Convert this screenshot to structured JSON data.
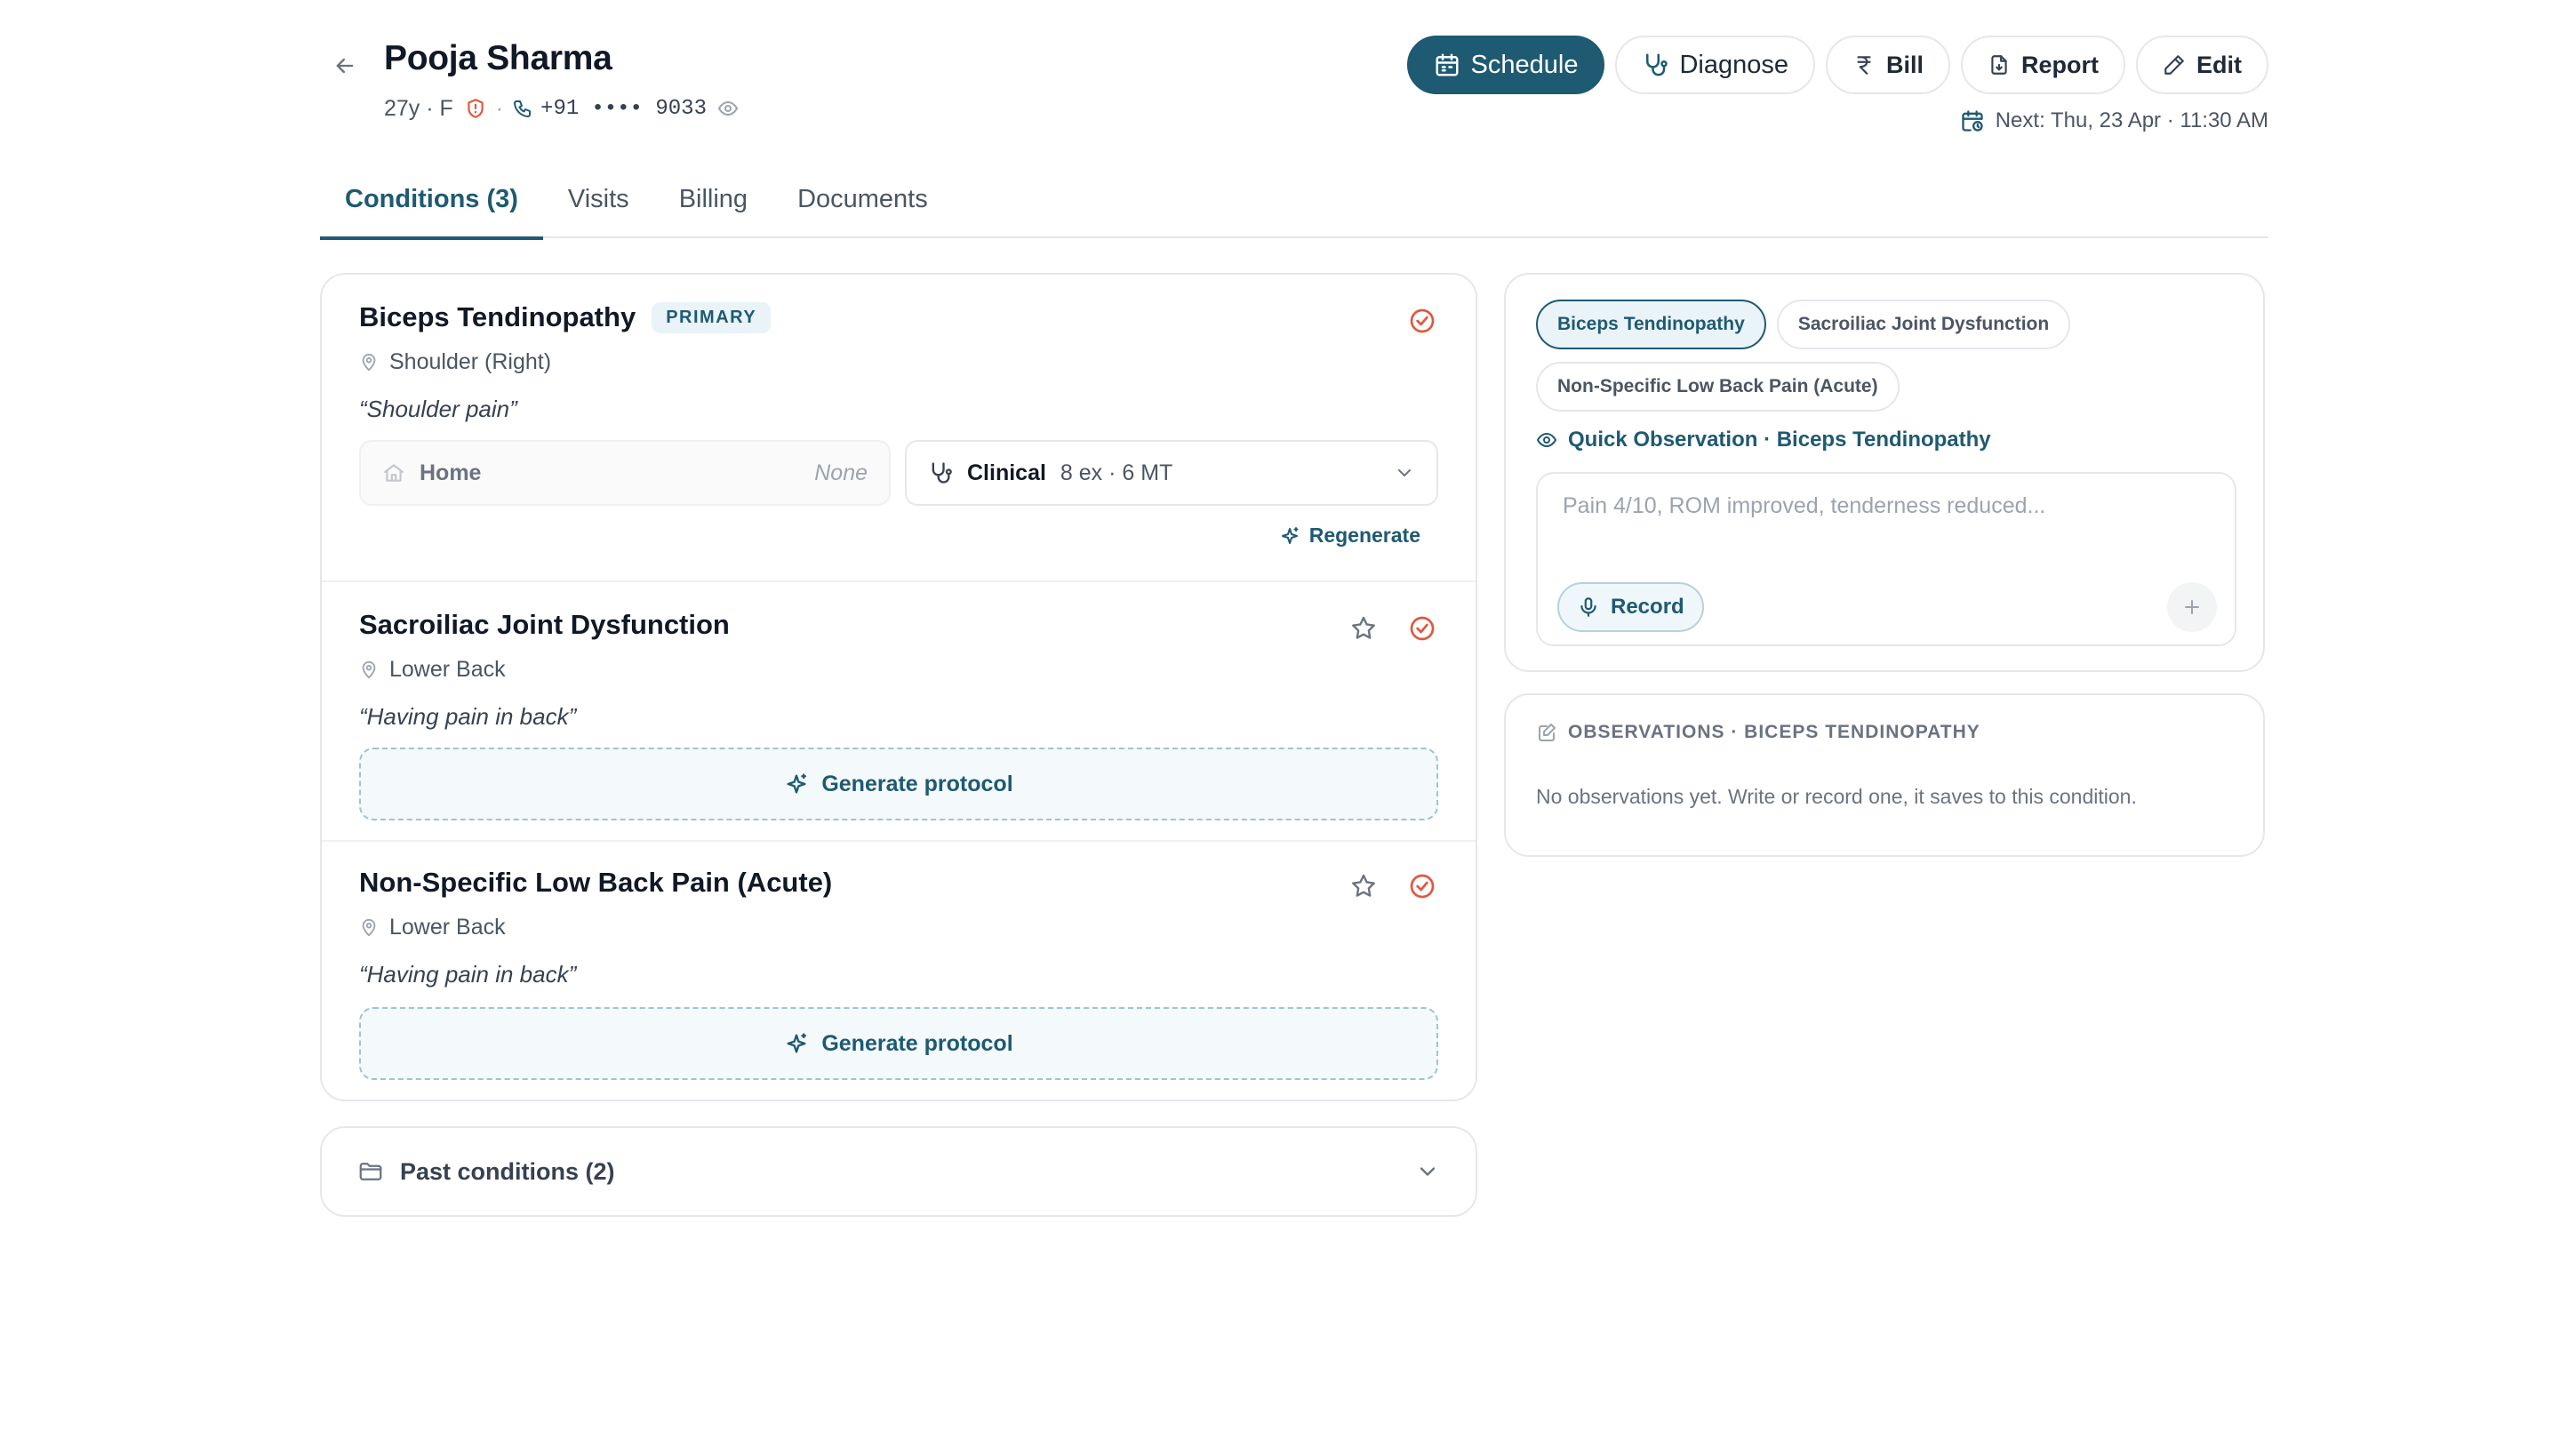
{
  "patient": {
    "name": "Pooja Sharma",
    "age_sex": "27y · F",
    "phone_prefix": "+91",
    "phone_masked": "••••  9033"
  },
  "actions": {
    "schedule": "Schedule",
    "diagnose": "Diagnose",
    "bill": "Bill",
    "report": "Report",
    "edit": "Edit"
  },
  "next_appointment": "Next: Thu, 23 Apr · 11:30 AM",
  "tabs": [
    {
      "label": "Conditions (3)",
      "active": true
    },
    {
      "label": "Visits",
      "active": false
    },
    {
      "label": "Billing",
      "active": false
    },
    {
      "label": "Documents",
      "active": false
    }
  ],
  "conditions": [
    {
      "title": "Biceps Tendinopathy",
      "badge": "PRIMARY",
      "location": "Shoulder (Right)",
      "quote": "“Shoulder pain”",
      "home_label": "Home",
      "home_value": "None",
      "clinical_label": "Clinical",
      "clinical_meta": "8 ex · 6 MT",
      "regenerate_label": "Regenerate"
    },
    {
      "title": "Sacroiliac Joint Dysfunction",
      "location": "Lower Back",
      "quote": "“Having pain in back”",
      "generate_label": "Generate protocol"
    },
    {
      "title": "Non-Specific Low Back Pain (Acute)",
      "location": "Lower Back",
      "quote": "“Having pain in back”",
      "generate_label": "Generate protocol"
    }
  ],
  "past_conditions": "Past conditions (2)",
  "observation": {
    "chips": [
      {
        "label": "Biceps Tendinopathy",
        "active": true
      },
      {
        "label": "Sacroiliac Joint Dysfunction",
        "active": false
      },
      {
        "label": "Non-Specific Low Back Pain (Acute)",
        "active": false
      }
    ],
    "title": "Quick Observation · Biceps Tendinopathy",
    "placeholder": "Pain 4/10, ROM improved, tenderness reduced...",
    "record_label": "Record"
  },
  "history": {
    "title": "OBSERVATIONS · BICEPS TENDINOPATHY",
    "empty": "No observations yet. Write or record one, it saves to this condition."
  },
  "colors": {
    "accent": "#1e5a72",
    "alert": "#e0573f"
  },
  "icons": [
    "back-arrow-icon",
    "shield-icon",
    "phone-icon",
    "eye-icon",
    "calendar-icon",
    "stethoscope-icon",
    "rupee-icon",
    "file-icon",
    "pencil-icon",
    "calendar-clock-icon",
    "map-pin-icon",
    "check-circle-icon",
    "star-icon",
    "home-icon",
    "sparkle-icon",
    "chevron-down-icon",
    "folder-icon",
    "mic-icon",
    "plus-icon",
    "note-icon"
  ]
}
